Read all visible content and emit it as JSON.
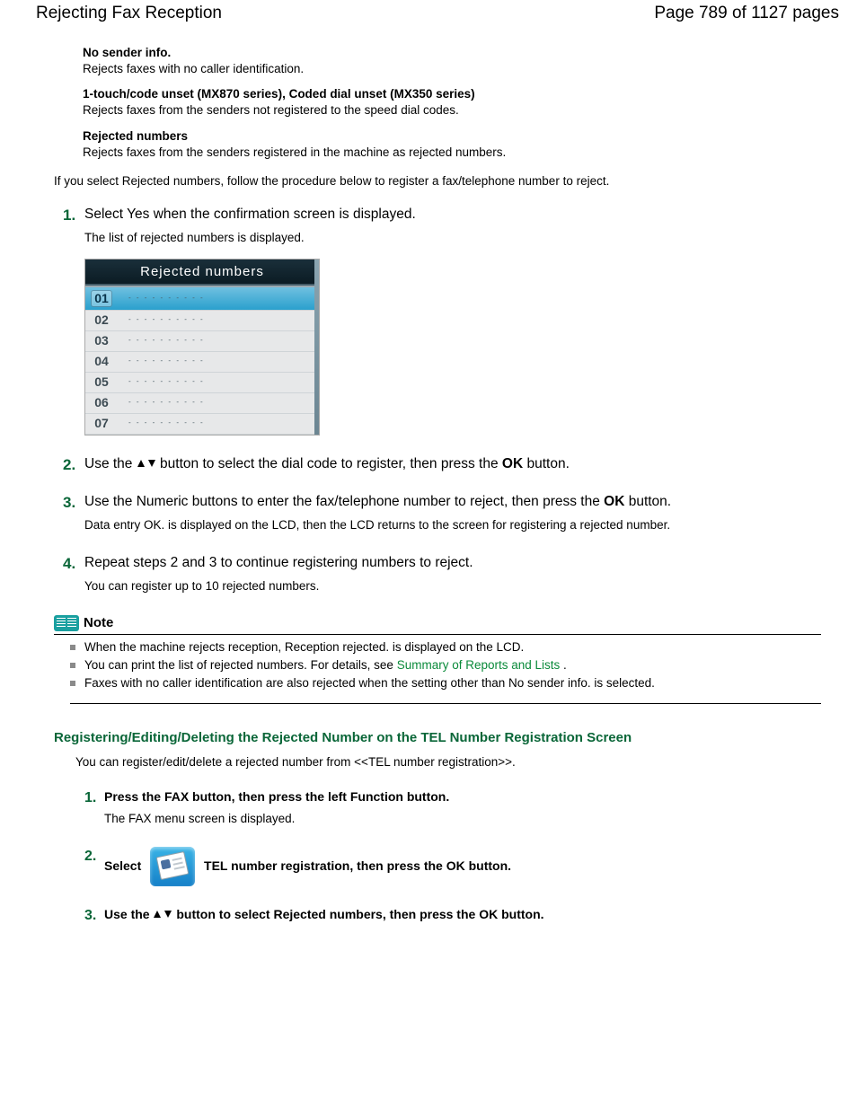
{
  "header": {
    "title": "Rejecting Fax Reception",
    "page_indicator": "Page 789 of 1127 pages"
  },
  "options": [
    {
      "title": "No sender info.",
      "desc": "Rejects faxes with no caller identification."
    },
    {
      "title": "1-touch/code unset (MX870 series), Coded dial unset (MX350 series)",
      "desc": "Rejects faxes from the senders not registered to the speed dial codes."
    },
    {
      "title": "Rejected numbers",
      "desc": "Rejects faxes from the senders registered in the machine as rejected numbers."
    }
  ],
  "intro": "If you select Rejected numbers, follow the procedure below to register a fax/telephone number to reject.",
  "steps": {
    "s1": {
      "title": "Select Yes when the confirmation screen is displayed.",
      "sub": "The list of rejected numbers is displayed."
    },
    "s2": {
      "pre": "Use the ",
      "mid": " button to select the dial code to register, then press the ",
      "ok": "OK",
      "post": " button."
    },
    "s3": {
      "pre": "Use the Numeric buttons to enter the fax/telephone number to reject, then press the ",
      "ok": "OK",
      "post": " button.",
      "sub": "Data entry OK. is displayed on the LCD, then the LCD returns to the screen for registering a rejected number."
    },
    "s4": {
      "title": "Repeat steps 2 and 3 to continue registering numbers to reject.",
      "sub": "You can register up to 10 rejected numbers."
    }
  },
  "lcd": {
    "title": "Rejected numbers",
    "rows": [
      "01",
      "02",
      "03",
      "04",
      "05",
      "06",
      "07"
    ],
    "placeholder": "- - - - - - - - - -"
  },
  "note": {
    "label": "Note",
    "items": {
      "n1": "When the machine rejects reception, Reception rejected. is displayed on the LCD.",
      "n2a": "You can print the list of rejected numbers. For details, see ",
      "n2link": "Summary of Reports and Lists",
      "n2b": " .",
      "n3": "Faxes with no caller identification are also rejected when the setting other than No sender info. is selected."
    }
  },
  "subsection": {
    "title": "Registering/Editing/Deleting the Rejected Number on the TEL Number Registration Screen",
    "intro": "You can register/edit/delete a rejected number from <<TEL number registration>>.",
    "steps": {
      "s1": {
        "pre": "Press the ",
        "fax": "FAX",
        "post": " button, then press the left Function button.",
        "sub": "The FAX menu screen is displayed."
      },
      "s2": {
        "pre": "Select ",
        "mid": " TEL number registration, then press the ",
        "ok": "OK",
        "post": " button."
      },
      "s3": {
        "pre": "Use the ",
        "mid": " button to select Rejected numbers, then press the ",
        "ok": "OK",
        "post": " button."
      }
    }
  }
}
